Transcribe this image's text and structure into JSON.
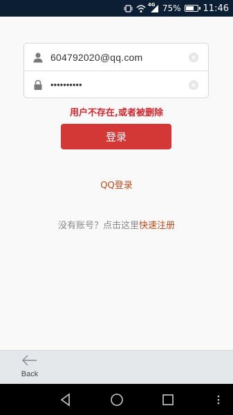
{
  "status_bar": {
    "network": "4G",
    "battery": "75%",
    "battery_level": 0.75,
    "time": "11:46"
  },
  "login_form": {
    "username": "604792020@qq.com",
    "password_masked": "••••••••••",
    "user_icon": "user-icon",
    "password_icon": "lock-icon",
    "clear_icon": "clear-icon"
  },
  "error_message": "用户不存在,或者被删除",
  "login_button": "登录",
  "qq_login": "QQ登录",
  "register": {
    "prompt": "没有账号？点击这里",
    "link": "快速注册"
  },
  "back_bar": {
    "label": "Back",
    "icon": "back-arrow-icon"
  },
  "colors": {
    "accent_red": "#d43836",
    "link_orange": "#bc4b1c",
    "status_bar_bg": "#0c1e33"
  }
}
